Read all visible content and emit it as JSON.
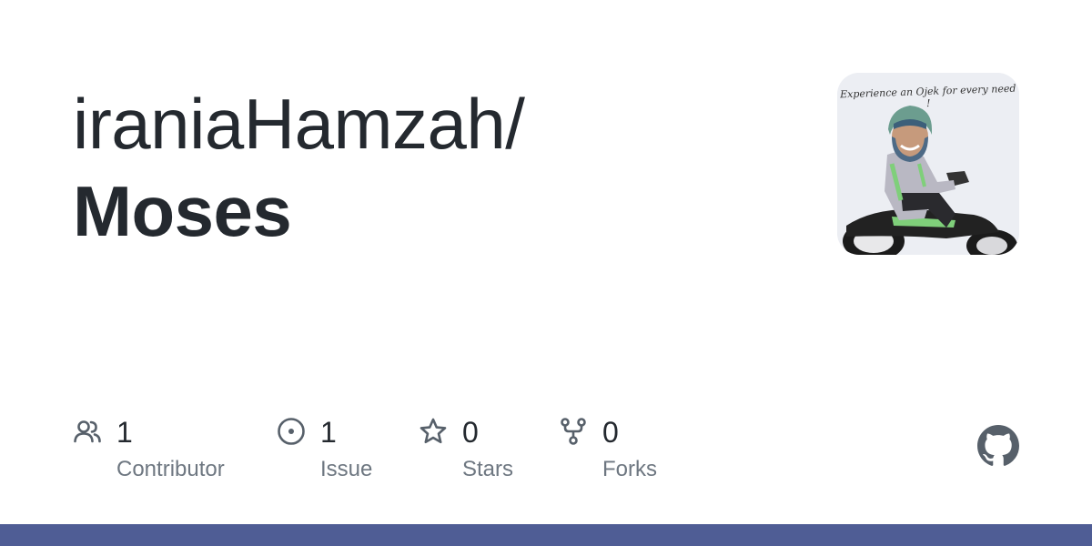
{
  "repo_card": {
    "owner": "iraniaHamzah/",
    "repo_name": "Moses",
    "avatar": {
      "caption": "Experience an Ojek for every need !"
    },
    "stats": [
      {
        "icon": "people-icon",
        "value": "1",
        "label": "Contributor"
      },
      {
        "icon": "issue-icon",
        "value": "1",
        "label": "Issue"
      },
      {
        "icon": "star-icon",
        "value": "0",
        "label": "Stars"
      },
      {
        "icon": "fork-icon",
        "value": "0",
        "label": "Forks"
      }
    ],
    "logo": "github-icon",
    "colors": {
      "text": "#24292f",
      "muted": "#6e7781",
      "icon": "#57606a",
      "bottom_bar": "#4f5d95"
    }
  }
}
